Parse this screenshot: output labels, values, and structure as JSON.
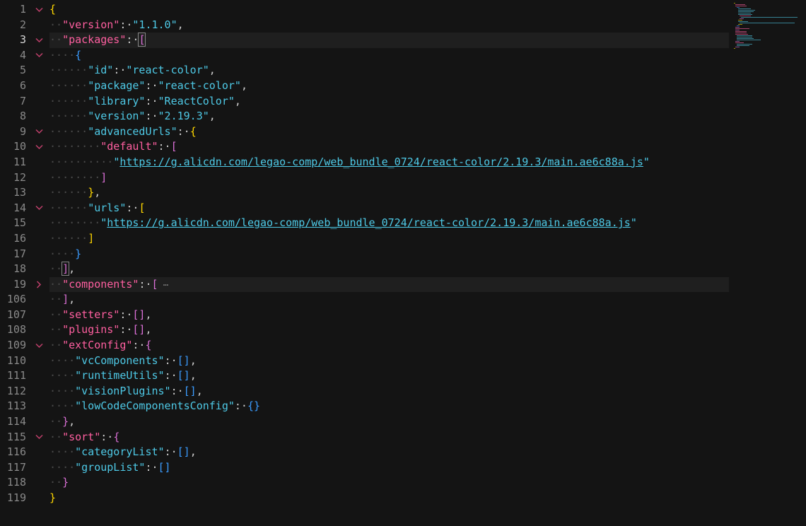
{
  "editor": {
    "lines": [
      {
        "n": "1",
        "fold": "open",
        "tokens": [
          [
            "b1",
            "{"
          ]
        ]
      },
      {
        "n": "2",
        "fold": "",
        "indent": 1,
        "tokens": [
          [
            "k",
            "\"version\""
          ],
          [
            "p",
            ": "
          ],
          [
            "s",
            "\"1.1.0\""
          ],
          [
            "p",
            ","
          ]
        ]
      },
      {
        "n": "3",
        "fold": "open",
        "indent": 1,
        "highlight": true,
        "tokens": [
          [
            "k",
            "\"packages\""
          ],
          [
            "p",
            ": "
          ],
          [
            "b2sel",
            "["
          ]
        ]
      },
      {
        "n": "4",
        "fold": "open",
        "indent": 2,
        "tokens": [
          [
            "b3",
            "{"
          ]
        ]
      },
      {
        "n": "5",
        "fold": "",
        "indent": 3,
        "tokens": [
          [
            "s",
            "\"id\""
          ],
          [
            "p",
            ": "
          ],
          [
            "s",
            "\"react-color\""
          ],
          [
            "p",
            ","
          ]
        ]
      },
      {
        "n": "6",
        "fold": "",
        "indent": 3,
        "tokens": [
          [
            "s",
            "\"package\""
          ],
          [
            "p",
            ": "
          ],
          [
            "s",
            "\"react-color\""
          ],
          [
            "p",
            ","
          ]
        ]
      },
      {
        "n": "7",
        "fold": "",
        "indent": 3,
        "tokens": [
          [
            "s",
            "\"library\""
          ],
          [
            "p",
            ": "
          ],
          [
            "s",
            "\"ReactColor\""
          ],
          [
            "p",
            ","
          ]
        ]
      },
      {
        "n": "8",
        "fold": "",
        "indent": 3,
        "tokens": [
          [
            "s",
            "\"version\""
          ],
          [
            "p",
            ": "
          ],
          [
            "s",
            "\"2.19.3\""
          ],
          [
            "p",
            ","
          ]
        ]
      },
      {
        "n": "9",
        "fold": "open",
        "indent": 3,
        "tokens": [
          [
            "s",
            "\"advancedUrls\""
          ],
          [
            "p",
            ": "
          ],
          [
            "b1",
            "{"
          ]
        ]
      },
      {
        "n": "10",
        "fold": "open",
        "indent": 4,
        "tokens": [
          [
            "k",
            "\"default\""
          ],
          [
            "p",
            ": "
          ],
          [
            "b2",
            "["
          ]
        ]
      },
      {
        "n": "11",
        "fold": "",
        "indent": 5,
        "tokens": [
          [
            "s",
            "\""
          ],
          [
            "u",
            "https://g.alicdn.com/legao-comp/web_bundle_0724/react-color/2.19.3/main.ae6c88a.js"
          ],
          [
            "s",
            "\""
          ]
        ]
      },
      {
        "n": "12",
        "fold": "",
        "indent": 4,
        "tokens": [
          [
            "b2",
            "]"
          ]
        ]
      },
      {
        "n": "13",
        "fold": "",
        "indent": 3,
        "tokens": [
          [
            "b1",
            "}"
          ],
          [
            "p",
            ","
          ]
        ]
      },
      {
        "n": "14",
        "fold": "open",
        "indent": 3,
        "tokens": [
          [
            "s",
            "\"urls\""
          ],
          [
            "p",
            ": "
          ],
          [
            "b1",
            "["
          ]
        ]
      },
      {
        "n": "15",
        "fold": "",
        "indent": 4,
        "tokens": [
          [
            "s",
            "\""
          ],
          [
            "u",
            "https://g.alicdn.com/legao-comp/web_bundle_0724/react-color/2.19.3/main.ae6c88a.js"
          ],
          [
            "s",
            "\""
          ]
        ]
      },
      {
        "n": "16",
        "fold": "",
        "indent": 3,
        "tokens": [
          [
            "b1",
            "]"
          ]
        ]
      },
      {
        "n": "17",
        "fold": "",
        "indent": 2,
        "tokens": [
          [
            "b3",
            "}"
          ]
        ]
      },
      {
        "n": "18",
        "fold": "",
        "indent": 1,
        "tokens": [
          [
            "b2sel",
            "]"
          ],
          [
            "p",
            ","
          ]
        ]
      },
      {
        "n": "19",
        "fold": "closed",
        "indent": 1,
        "highlight": true,
        "tokens": [
          [
            "k",
            "\"components\""
          ],
          [
            "p",
            ": "
          ],
          [
            "b2",
            "["
          ],
          [
            "ellipsis",
            " ⋯"
          ]
        ]
      },
      {
        "n": "106",
        "fold": "",
        "indent": 1,
        "tokens": [
          [
            "b2",
            "]"
          ],
          [
            "p",
            ","
          ]
        ]
      },
      {
        "n": "107",
        "fold": "",
        "indent": 1,
        "tokens": [
          [
            "k",
            "\"setters\""
          ],
          [
            "p",
            ": "
          ],
          [
            "b2",
            "[]"
          ],
          [
            "p",
            ","
          ]
        ]
      },
      {
        "n": "108",
        "fold": "",
        "indent": 1,
        "tokens": [
          [
            "k",
            "\"plugins\""
          ],
          [
            "p",
            ": "
          ],
          [
            "b2",
            "[]"
          ],
          [
            "p",
            ","
          ]
        ]
      },
      {
        "n": "109",
        "fold": "open",
        "indent": 1,
        "tokens": [
          [
            "k",
            "\"extConfig\""
          ],
          [
            "p",
            ": "
          ],
          [
            "b2",
            "{"
          ]
        ]
      },
      {
        "n": "110",
        "fold": "",
        "indent": 2,
        "tokens": [
          [
            "s",
            "\"vcComponents\""
          ],
          [
            "p",
            ": "
          ],
          [
            "b3",
            "[]"
          ],
          [
            "p",
            ","
          ]
        ]
      },
      {
        "n": "111",
        "fold": "",
        "indent": 2,
        "tokens": [
          [
            "s",
            "\"runtimeUtils\""
          ],
          [
            "p",
            ": "
          ],
          [
            "b3",
            "[]"
          ],
          [
            "p",
            ","
          ]
        ]
      },
      {
        "n": "112",
        "fold": "",
        "indent": 2,
        "tokens": [
          [
            "s",
            "\"visionPlugins\""
          ],
          [
            "p",
            ": "
          ],
          [
            "b3",
            "[]"
          ],
          [
            "p",
            ","
          ]
        ]
      },
      {
        "n": "113",
        "fold": "",
        "indent": 2,
        "tokens": [
          [
            "s",
            "\"lowCodeComponentsConfig\""
          ],
          [
            "p",
            ": "
          ],
          [
            "b3",
            "{}"
          ]
        ]
      },
      {
        "n": "114",
        "fold": "",
        "indent": 1,
        "tokens": [
          [
            "b2",
            "}"
          ],
          [
            "p",
            ","
          ]
        ]
      },
      {
        "n": "115",
        "fold": "open",
        "indent": 1,
        "tokens": [
          [
            "k",
            "\"sort\""
          ],
          [
            "p",
            ": "
          ],
          [
            "b2",
            "{"
          ]
        ]
      },
      {
        "n": "116",
        "fold": "",
        "indent": 2,
        "tokens": [
          [
            "s",
            "\"categoryList\""
          ],
          [
            "p",
            ": "
          ],
          [
            "b3",
            "[]"
          ],
          [
            "p",
            ","
          ]
        ]
      },
      {
        "n": "117",
        "fold": "",
        "indent": 2,
        "tokens": [
          [
            "s",
            "\"groupList\""
          ],
          [
            "p",
            ": "
          ],
          [
            "b3",
            "[]"
          ]
        ]
      },
      {
        "n": "118",
        "fold": "",
        "indent": 1,
        "tokens": [
          [
            "b2",
            "}"
          ]
        ]
      },
      {
        "n": "119",
        "fold": "",
        "indent": 0,
        "tokens": [
          [
            "b1",
            "}"
          ]
        ]
      }
    ],
    "active_line": "3",
    "icons": {
      "fold_open": "chevron-down-icon",
      "fold_closed": "chevron-right-icon"
    },
    "colors": {
      "background": "#141414",
      "key": "#ff5fa0",
      "string": "#4ec9e6",
      "bracket_gold": "#ffd700",
      "bracket_purple": "#da70d6",
      "bracket_blue": "#3b9cff"
    }
  }
}
